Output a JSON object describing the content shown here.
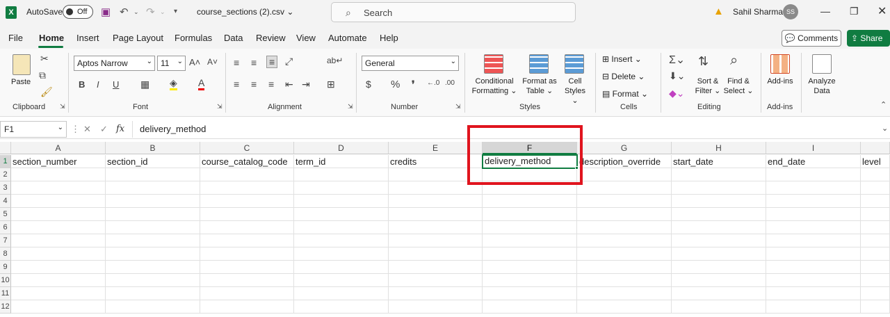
{
  "titlebar": {
    "autosave_label": "AutoSave",
    "autosave_state": "Off",
    "filename": "course_sections (2).csv",
    "search_placeholder": "Search",
    "user_name": "Sahil Sharma",
    "user_initials": "SS"
  },
  "menu": {
    "items": [
      "File",
      "Home",
      "Insert",
      "Page Layout",
      "Formulas",
      "Data",
      "Review",
      "View",
      "Automate",
      "Help"
    ],
    "active": "Home",
    "comments_label": "Comments",
    "share_label": "Share"
  },
  "ribbon": {
    "clipboard": {
      "label": "Clipboard",
      "paste": "Paste"
    },
    "font": {
      "label": "Font",
      "font_name": "Aptos Narrow",
      "font_size": "11"
    },
    "alignment": {
      "label": "Alignment"
    },
    "number": {
      "label": "Number",
      "format": "General"
    },
    "styles": {
      "label": "Styles",
      "conditional_1": "Conditional",
      "conditional_2": "Formatting",
      "format_table_1": "Format as",
      "format_table_2": "Table",
      "cell_styles_1": "Cell",
      "cell_styles_2": "Styles"
    },
    "cells": {
      "label": "Cells",
      "insert": "Insert",
      "delete": "Delete",
      "format": "Format"
    },
    "editing": {
      "label": "Editing",
      "sort_1": "Sort &",
      "sort_2": "Filter",
      "find_1": "Find &",
      "find_2": "Select"
    },
    "addins": {
      "label": "Add-ins",
      "button": "Add-ins"
    },
    "analyze": {
      "label_1": "Analyze",
      "label_2": "Data"
    }
  },
  "formula_bar": {
    "name_box": "F1",
    "fx": "fx",
    "content": "delivery_method"
  },
  "sheet": {
    "columns": [
      "A",
      "B",
      "C",
      "D",
      "E",
      "F",
      "G",
      "H",
      "I"
    ],
    "rows": [
      "1",
      "2",
      "3",
      "4",
      "5",
      "6",
      "7",
      "8",
      "9",
      "10",
      "11",
      "12"
    ],
    "row1": [
      "section_number",
      "section_id",
      "course_catalog_code",
      "term_id",
      "credits",
      "delivery_method",
      "description_override",
      "start_date",
      "end_date",
      "level"
    ]
  },
  "colors": {
    "excel_green": "#107c41",
    "annotation_red": "#e0141e"
  }
}
